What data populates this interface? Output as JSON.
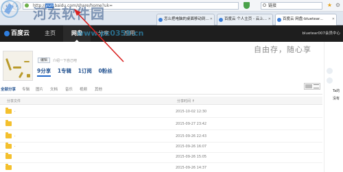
{
  "browser": {
    "url_prefix": "http://",
    "url_highlight": "yun",
    "url_rest": ".baidu.com/share/home?uk=",
    "search_value": "链接"
  },
  "tabs": [
    {
      "label": "怎么把电脑的桌面移动到..."
    },
    {
      "label": "百度云 个人主页 - 云上..."
    },
    {
      "label": "百度云 网盘-bluetear..."
    }
  ],
  "watermark": {
    "title": "河东软件园",
    "url": "www.pc0359.cn"
  },
  "header": {
    "logo": "百度云",
    "nav": [
      {
        "label": "主页"
      },
      {
        "label": "网盘"
      },
      {
        "label": "分享"
      },
      {
        "label": "应用"
      }
    ],
    "user": "bluetear007",
    "extra": "会员中心"
  },
  "profile": {
    "edit_label": "编辑",
    "intro": "介绍一下自己吧",
    "stats": [
      {
        "label": "9分享"
      },
      {
        "label": "1专辑"
      },
      {
        "label": "1订阅"
      },
      {
        "label": "0粉丝"
      }
    ],
    "slogan": "自由存，随心享"
  },
  "filter_tabs": [
    {
      "label": "全部分享"
    },
    {
      "label": "专辑"
    },
    {
      "label": "图片"
    },
    {
      "label": "文档"
    },
    {
      "label": "音乐"
    },
    {
      "label": "视频"
    },
    {
      "label": "其他"
    }
  ],
  "table": {
    "col_name": "分享文件",
    "col_time": "分享时间",
    "sort_icon": "arrow-up-icon",
    "rows": [
      {
        "name": "·",
        "date": "2015-10-02 12:30"
      },
      {
        "name": "",
        "date": "2015-09-27 23:42"
      },
      {
        "name": "·",
        "date": "2015-09-26 22:43"
      },
      {
        "name": "·",
        "date": "2015-09-26 16:07"
      },
      {
        "name": "",
        "date": "2015-09-26 15:05"
      },
      {
        "name": "",
        "date": "2015-09-26 14:37"
      }
    ]
  },
  "right_panel": {
    "line1": "Ta的",
    "line2": "没有"
  },
  "colors": {
    "header_bg": "#1e1e1e",
    "accent": "#1f4f8e",
    "folder": "#f4c02d",
    "arrow": "#d9201f"
  }
}
